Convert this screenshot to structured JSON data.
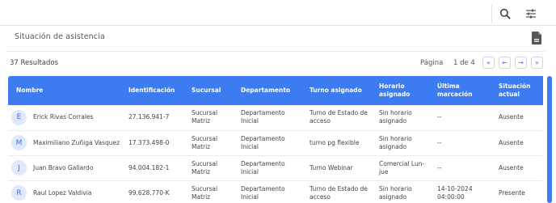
{
  "header": {
    "search_icon": "search-icon",
    "filter_icon": "sliders-icon"
  },
  "section": {
    "title": "Situación de asistencia",
    "export_icon": "pdf-file-icon"
  },
  "results": {
    "label": "37 Resultados"
  },
  "pagination": {
    "label": "Página",
    "info": "1 de 4",
    "first": "«",
    "prev": "←",
    "next": "→",
    "last": "»"
  },
  "table": {
    "columns": [
      "Nombre",
      "Identificación",
      "Sucursal",
      "Departamento",
      "Turno asignado",
      "Horario asignado",
      "Última marcación",
      "Situación actual"
    ],
    "rows": [
      {
        "initial": "E",
        "name": "Erick Rivas Corrales",
        "id": "27.136.941-7",
        "branch": "Sucursal Matriz",
        "dept": "Departamento Inicial",
        "shift": "Turno de Estado de acceso",
        "schedule": "Sin horario asignado",
        "last": "--",
        "status": "Ausente"
      },
      {
        "initial": "M",
        "name": "Maximiliano Zuñiga Vasquez",
        "id": "17.373.498-0",
        "branch": "Sucursal Matriz",
        "dept": "Departamento Inicial",
        "shift": "turno pg flexible",
        "schedule": "Sin horario asignado",
        "last": "--",
        "status": "Ausente"
      },
      {
        "initial": "J",
        "name": "Juan Bravo Gallardo",
        "id": "94.004.182-1",
        "branch": "Sucursal Matriz",
        "dept": "Departamento Inicial",
        "shift": "Turno Webinar",
        "schedule": "Comercial Lun-jue",
        "last": "--",
        "status": "Ausente"
      },
      {
        "initial": "R",
        "name": "Raul Lopez Valdivia",
        "id": "99.628.770-K",
        "branch": "Sucursal Matriz",
        "dept": "Departamento Inicial",
        "shift": "Turno de Estado de acceso",
        "schedule": "Sin horario asignado",
        "last": "14-10-2024 04:00:00",
        "status": "Presente"
      }
    ]
  },
  "colors": {
    "accent": "#3d7bf0",
    "avatar_bg": "#dfe9fb"
  }
}
